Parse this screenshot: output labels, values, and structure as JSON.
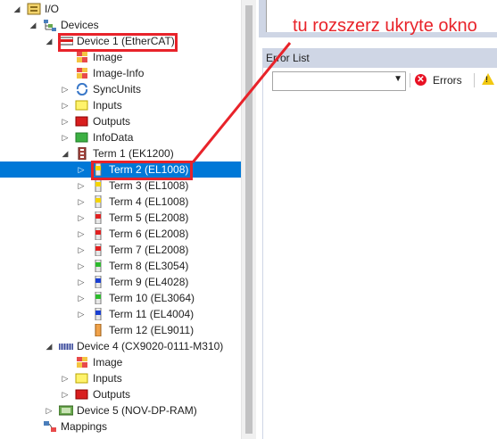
{
  "tree": {
    "items": [
      {
        "label": "I/O",
        "icon": "io-folder-icon",
        "expander": "◢"
      },
      {
        "label": "Devices",
        "icon": "devices-icon",
        "expander": "◢"
      },
      {
        "label": "Device 1 (EtherCAT)",
        "icon": "ethercat-device-icon",
        "expander": "◢"
      },
      {
        "label": "Image",
        "icon": "image-icon",
        "expander": ""
      },
      {
        "label": "Image-Info",
        "icon": "image-info-icon",
        "expander": ""
      },
      {
        "label": "SyncUnits",
        "icon": "syncunits-icon",
        "expander": "▷"
      },
      {
        "label": "Inputs",
        "icon": "inputs-icon",
        "expander": "▷"
      },
      {
        "label": "Outputs",
        "icon": "outputs-icon",
        "expander": "▷"
      },
      {
        "label": "InfoData",
        "icon": "infodata-icon",
        "expander": "▷"
      },
      {
        "label": "Term 1 (EK1200)",
        "icon": "coupler-icon",
        "expander": "◢"
      },
      {
        "label": "Term 2 (EL1008)",
        "icon": "terminal-yellow-icon",
        "expander": "▷",
        "selected": true
      },
      {
        "label": "Term 3 (EL1008)",
        "icon": "terminal-yellow-icon",
        "expander": "▷"
      },
      {
        "label": "Term 4 (EL1008)",
        "icon": "terminal-yellow-icon",
        "expander": "▷"
      },
      {
        "label": "Term 5 (EL2008)",
        "icon": "terminal-red-icon",
        "expander": "▷"
      },
      {
        "label": "Term 6 (EL2008)",
        "icon": "terminal-red-icon",
        "expander": "▷"
      },
      {
        "label": "Term 7 (EL2008)",
        "icon": "terminal-red-icon",
        "expander": "▷"
      },
      {
        "label": "Term 8 (EL3054)",
        "icon": "terminal-green-icon",
        "expander": "▷"
      },
      {
        "label": "Term 9 (EL4028)",
        "icon": "terminal-blue-icon",
        "expander": "▷"
      },
      {
        "label": "Term 10 (EL3064)",
        "icon": "terminal-green-icon",
        "expander": "▷"
      },
      {
        "label": "Term 11 (EL4004)",
        "icon": "terminal-blue-icon",
        "expander": "▷"
      },
      {
        "label": "Term 12 (EL9011)",
        "icon": "end-terminal-icon",
        "expander": ""
      },
      {
        "label": "Device 4 (CX9020-0111-M310)",
        "icon": "cx-device-icon",
        "expander": "◢"
      },
      {
        "label": "Image",
        "icon": "image-icon",
        "expander": ""
      },
      {
        "label": "Inputs",
        "icon": "inputs-icon",
        "expander": "▷"
      },
      {
        "label": "Outputs",
        "icon": "outputs-icon",
        "expander": "▷"
      },
      {
        "label": "Device 5 (NOV-DP-RAM)",
        "icon": "profibus-device-icon",
        "expander": "▷"
      },
      {
        "label": "Mappings",
        "icon": "mappings-icon",
        "expander": ""
      }
    ]
  },
  "annotation": {
    "text": "tu rozszerz ukryte okno",
    "color": "#e8232a"
  },
  "error_list": {
    "title": "Error List",
    "scope_value": "",
    "errors_label": "Errors"
  },
  "colors": {
    "selection": "#0078d7",
    "highlight": "#e8232a",
    "panel_header": "#cfd6e5"
  }
}
